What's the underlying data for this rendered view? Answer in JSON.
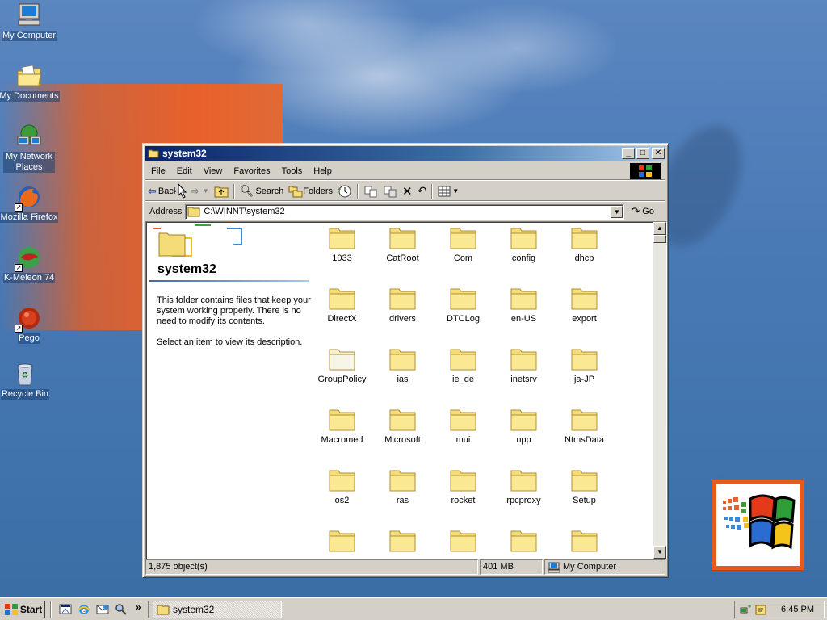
{
  "desktop": {
    "icons": [
      {
        "label": "My Computer"
      },
      {
        "label": "My Documents"
      },
      {
        "label": "My Network Places"
      },
      {
        "label": "Mozilla Firefox"
      },
      {
        "label": "K-Meleon 74"
      },
      {
        "label": "Pego"
      },
      {
        "label": "Recycle Bin"
      }
    ]
  },
  "window": {
    "title": "system32",
    "menu": [
      "File",
      "Edit",
      "View",
      "Favorites",
      "Tools",
      "Help"
    ],
    "toolbar": {
      "back": "Back",
      "search": "Search",
      "folders": "Folders"
    },
    "address": {
      "label": "Address",
      "value": "C:\\WINNT\\system32",
      "go": "Go"
    },
    "left_pane": {
      "title": "system32",
      "description": "This folder contains files that keep your system working properly. There is no need to modify its contents.",
      "select_hint": "Select an item to view its description."
    },
    "folders": [
      "1033",
      "CatRoot",
      "Com",
      "config",
      "dhcp",
      "DirectX",
      "drivers",
      "DTCLog",
      "en-US",
      "export",
      "GroupPolicy",
      "ias",
      "ie_de",
      "inetsrv",
      "ja-JP",
      "Macromed",
      "Microsoft",
      "mui",
      "npp",
      "NtmsData",
      "os2",
      "ras",
      "rocket",
      "rpcproxy",
      "Setup",
      "",
      "",
      "",
      "",
      ""
    ],
    "status": {
      "objects": "1,875 object(s)",
      "size": "401 MB",
      "zone": "My Computer"
    }
  },
  "taskbar": {
    "start": "Start",
    "task": "system32",
    "clock": "6:45 PM"
  },
  "colors": {
    "desktop": "#3a6ea5",
    "titlebar_start": "#0a246a",
    "titlebar_end": "#a6caf0",
    "chrome": "#d4d0c8",
    "folder": "#f4dc78"
  }
}
